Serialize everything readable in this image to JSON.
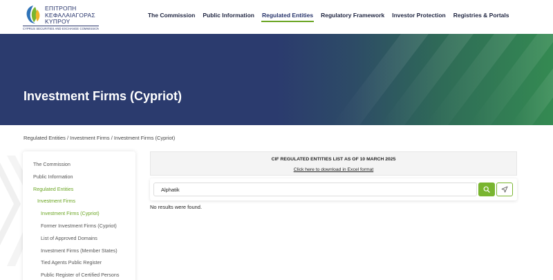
{
  "header": {
    "logo_lines": [
      "ΕΠΙΤΡΟΠΗ",
      "ΚΕΦΑΛΑΙΑΓΟΡΑΣ",
      "ΚΥΠΡΟΥ"
    ],
    "logo_sub": "CYPRUS SECURITIES AND EXCHANGE COMMISSION",
    "nav": [
      {
        "label": "The Commission"
      },
      {
        "label": "Public Information"
      },
      {
        "label": "Regulated Entities"
      },
      {
        "label": "Regulatory Framework"
      },
      {
        "label": "Investor Protection"
      },
      {
        "label": "Registries & Portals"
      }
    ],
    "active_nav": "Regulated Entities"
  },
  "hero": {
    "title": "Investment Firms (Cypriot)"
  },
  "breadcrumb": "Regulated Entities / Investment Firms / Investment Firms (Cypriot)",
  "sidebar": {
    "items": [
      {
        "label": "The Commission"
      },
      {
        "label": "Public Information"
      },
      {
        "label": "Regulated Entities"
      },
      {
        "label": "Investment Firms"
      },
      {
        "label": "Investment Firms (Cypriot)"
      },
      {
        "label": "Former Investment Firms (Cypriot)"
      },
      {
        "label": "List of Approved Domains"
      },
      {
        "label": "Investment Firms (Member States)"
      },
      {
        "label": "Tied Agents Public Register"
      },
      {
        "label": "Public Register of Certified Persons"
      }
    ]
  },
  "notice": {
    "title": "CIF REGULATED ENTITIES LIST AS OF 10 MARCH 2025",
    "link": "Click here to download in Excel format"
  },
  "search": {
    "value": "Alphatik",
    "search_icon": "search-icon",
    "reset_icon": "send-icon"
  },
  "results": {
    "message": "No results were found."
  },
  "colors": {
    "brand_navy": "#2b3b6e",
    "accent_green": "#6aa522",
    "button_green": "#79b530"
  }
}
